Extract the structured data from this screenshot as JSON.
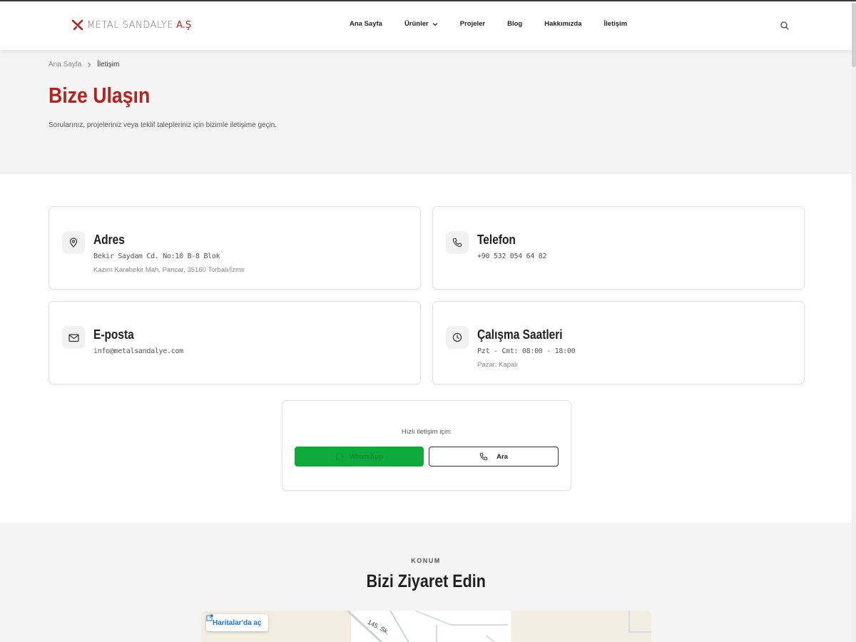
{
  "brand": {
    "name": "METAL SANDALYE",
    "suffix": "A.Ş"
  },
  "nav": {
    "items": [
      "Ana Sayfa",
      "Ürünler",
      "Projeler",
      "Blog",
      "Hakkımızda",
      "İletişim"
    ]
  },
  "breadcrumb": {
    "home": "Ana Sayfa",
    "current": "İletişim"
  },
  "hero": {
    "title": "Bize Ulaşın",
    "subtitle": "Sorularınız, projeleriniz veya teklif talepleriniz için bizimle iletişime geçin."
  },
  "contact": {
    "address": {
      "title": "Adres",
      "line1": "Bekir Saydam Cd. No:10 B-8 Blok",
      "line2": "Kazım Karabekir Mah. Pancar, 35160 Torbalı/İzmir"
    },
    "phone": {
      "title": "Telefon",
      "line1": "+90 532 054 64 82"
    },
    "email": {
      "title": "E-posta",
      "line1": "info@metalsandalye.com"
    },
    "hours": {
      "title": "Çalışma Saatleri",
      "line1": "Pzt - Cmt: 08:00 - 18:00",
      "line2": "Pazar: Kapalı"
    }
  },
  "quick": {
    "label": "Hızlı iletişim için:",
    "whatsapp": "WhatsApp",
    "call": "Ara"
  },
  "location": {
    "eyebrow": "KONUM",
    "title": "Bizi Ziyaret Edin",
    "map_button": "Haritalar'da aç",
    "street": "145. Sk."
  },
  "colors": {
    "accent": "#b32421",
    "whatsapp": "#0faa3c",
    "map_link": "#1a73e8"
  }
}
